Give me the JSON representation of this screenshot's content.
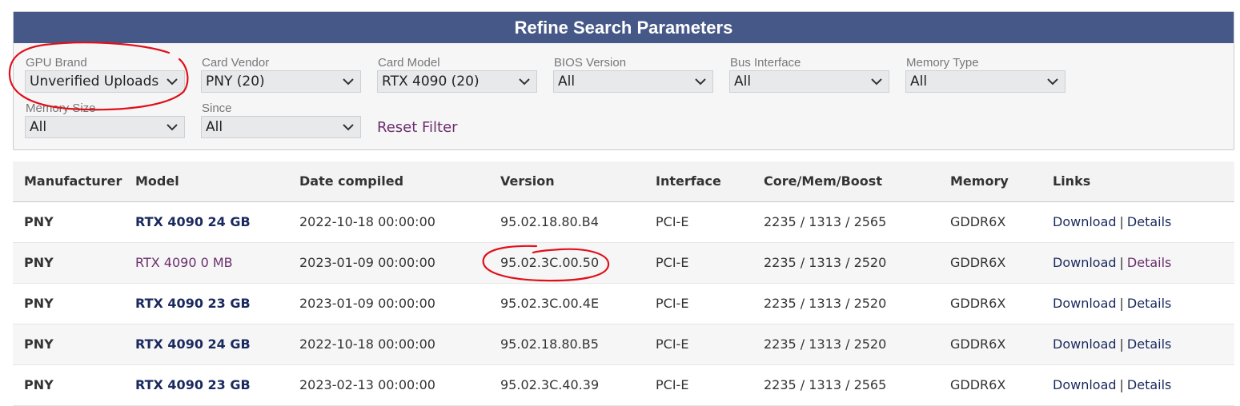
{
  "filter_panel": {
    "title": "Refine Search Parameters",
    "fields": [
      {
        "label": "GPU Brand",
        "value": "Unverified Uploads"
      },
      {
        "label": "Card Vendor",
        "value": "PNY (20)"
      },
      {
        "label": "Card Model",
        "value": "RTX 4090 (20)"
      },
      {
        "label": "BIOS Version",
        "value": "All"
      },
      {
        "label": "Bus Interface",
        "value": "All"
      },
      {
        "label": "Memory Type",
        "value": "All"
      },
      {
        "label": "Memory Size",
        "value": "All"
      },
      {
        "label": "Since",
        "value": "All"
      }
    ],
    "reset_label": "Reset Filter"
  },
  "table": {
    "columns": [
      "Manufacturer",
      "Model",
      "Date compiled",
      "Version",
      "Interface",
      "Core/Mem/Boost",
      "Memory",
      "Links"
    ],
    "rows": [
      {
        "manufacturer": "PNY",
        "model": "RTX 4090 24 GB",
        "date": "2022-10-18 00:00:00",
        "version": "95.02.18.80.B4",
        "interface": "PCI-E",
        "clocks": "2235 / 1313 / 2565",
        "memory": "GDDR6X",
        "download": "Download",
        "details": "Details"
      },
      {
        "manufacturer": "PNY",
        "model": "RTX 4090 0 MB",
        "date": "2023-01-09 00:00:00",
        "version": "95.02.3C.00.50",
        "interface": "PCI-E",
        "clocks": "2235 / 1313 / 2520",
        "memory": "GDDR6X",
        "download": "Download",
        "details": "Details"
      },
      {
        "manufacturer": "PNY",
        "model": "RTX 4090 23 GB",
        "date": "2023-01-09 00:00:00",
        "version": "95.02.3C.00.4E",
        "interface": "PCI-E",
        "clocks": "2235 / 1313 / 2520",
        "memory": "GDDR6X",
        "download": "Download",
        "details": "Details"
      },
      {
        "manufacturer": "PNY",
        "model": "RTX 4090 24 GB",
        "date": "2022-10-18 00:00:00",
        "version": "95.02.18.80.B5",
        "interface": "PCI-E",
        "clocks": "2235 / 1313 / 2520",
        "memory": "GDDR6X",
        "download": "Download",
        "details": "Details"
      },
      {
        "manufacturer": "PNY",
        "model": "RTX 4090 23 GB",
        "date": "2023-02-13 00:00:00",
        "version": "95.02.3C.40.39",
        "interface": "PCI-E",
        "clocks": "2235 / 1313 / 2565",
        "memory": "GDDR6X",
        "download": "Download",
        "details": "Details"
      }
    ]
  },
  "colors": {
    "header_bg": "#455887",
    "link": "#1a2a5e",
    "visited_link": "#6b2f6b",
    "annotation": "#e0101a"
  }
}
